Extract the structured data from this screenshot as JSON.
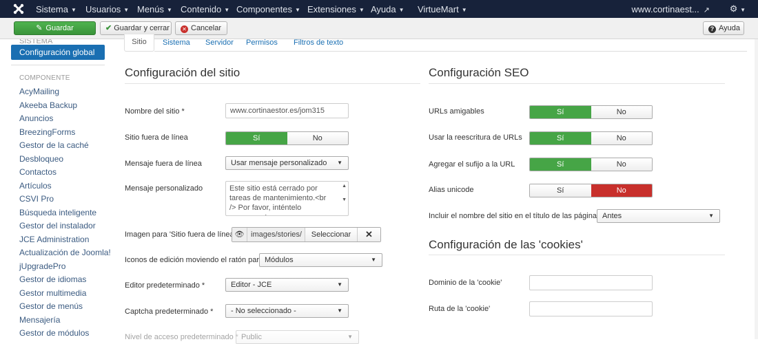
{
  "navbar": {
    "menu": [
      {
        "label": "Sistema"
      },
      {
        "label": "Usuarios"
      },
      {
        "label": "Menús"
      },
      {
        "label": "Contenido"
      },
      {
        "label": "Componentes"
      },
      {
        "label": "Extensiones"
      },
      {
        "label": "Ayuda"
      },
      {
        "label": "VirtueMart"
      }
    ],
    "site_link": "www.cortinaest...",
    "icons": {
      "logo": "joomla-logo-icon",
      "external": "external-link-icon",
      "gear": "gear-icon"
    }
  },
  "toolbar": {
    "save": "Guardar",
    "save_close": "Guardar y cerrar",
    "cancel": "Cancelar",
    "help": "Ayuda"
  },
  "sidebar": {
    "cut_item": "SISTEMA",
    "active": "Configuración global",
    "heading": "COMPONENTE",
    "items": [
      "AcyMailing",
      "Akeeba Backup",
      "Anuncios",
      "BreezingForms",
      "Gestor de la caché",
      "Desbloqueo",
      "Contactos",
      "Artículos",
      "CSVI Pro",
      "Búsqueda inteligente",
      "Gestor del instalador",
      "JCE Administration",
      "Actualización de Joomla!",
      "jUpgradePro",
      "Gestor de idiomas",
      "Gestor multimedia",
      "Gestor de menús",
      "Mensajería",
      "Gestor de módulos"
    ]
  },
  "tabs": [
    "Sitio",
    "Sistema",
    "Servidor",
    "Permisos",
    "Filtros de texto"
  ],
  "site": {
    "heading": "Configuración del sitio",
    "name_label": "Nombre del sitio *",
    "name_value": "www.cortinaestor.es/jom315",
    "offline_label": "Sitio fuera de línea",
    "offline_message_label": "Mensaje fuera de línea",
    "offline_message_value": "Usar mensaje personalizado",
    "custom_message_label": "Mensaje personalizado",
    "custom_message_value": "Este sitio está cerrado por tareas de mantenimiento.<br /> Por favor, inténtelo nuevamente",
    "offline_image_label": "Imagen para 'Sitio fuera de línea'",
    "offline_image_path": "images/stories/",
    "offline_image_select": "Seleccionar",
    "edit_icons_label": "Iconos de edición moviendo el ratón para",
    "edit_icons_value": "Módulos",
    "editor_label": "Editor predeterminado *",
    "editor_value": "Editor - JCE",
    "captcha_label": "Captcha predeterminado *",
    "captcha_value": "- No seleccionado -",
    "access_label": "Nivel de acceso predeterminado *",
    "access_value": "Public"
  },
  "seo": {
    "heading": "Configuración SEO",
    "sef_label": "URLs amigables",
    "rewrite_label": "Usar la reescritura de URLs",
    "suffix_label": "Agregar el sufijo a la URL",
    "unicode_label": "Alias unicode",
    "sitename_label": "Incluir el nombre del sitio en el título de las páginas",
    "sitename_value": "Antes"
  },
  "cookies": {
    "heading": "Configuración de las 'cookies'",
    "domain_label": "Dominio de la 'cookie'",
    "domain_value": "",
    "path_label": "Ruta de la 'cookie'",
    "path_value": ""
  },
  "toggle": {
    "yes": "Sí",
    "no": "No"
  },
  "states": {
    "offline": "Sí",
    "sef": "Sí",
    "rewrite": "Sí",
    "suffix": "Sí",
    "unicode": "No"
  },
  "colors": {
    "navbar": "#17223a",
    "active_blue": "#1a6fb2",
    "yes_green": "#46a546",
    "no_red": "#c8302c"
  }
}
